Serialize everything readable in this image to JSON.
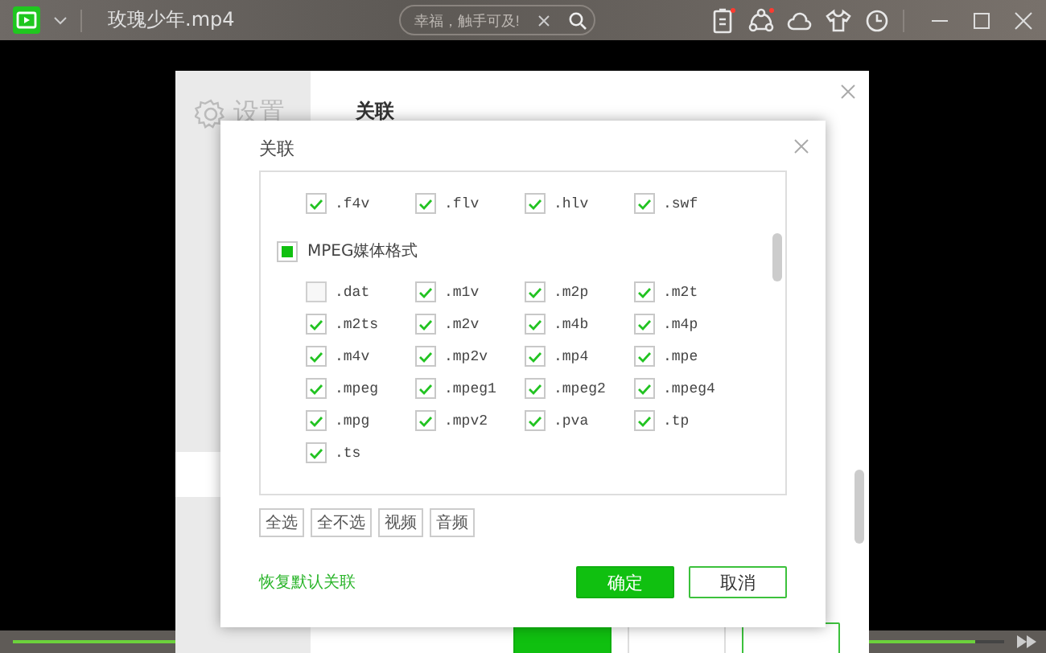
{
  "player": {
    "title": "玫瑰少年.mp4",
    "search": {
      "placeholder": "幸福，触手可及!"
    },
    "icons": [
      {
        "kind": "doc",
        "dot": true
      },
      {
        "kind": "share",
        "dot": true
      },
      {
        "kind": "cloud",
        "dot": false
      },
      {
        "kind": "shirt",
        "dot": false
      },
      {
        "kind": "clock",
        "dot": false
      }
    ],
    "progress": {
      "level": 0.97
    }
  },
  "settings": {
    "title": "设置",
    "section": "关联",
    "buttons": [
      {
        "kind": "primary"
      },
      {
        "kind": "disabled"
      },
      {
        "kind": "outline"
      }
    ]
  },
  "dialog": {
    "title": "关联",
    "groups": [
      {
        "items": [
          {
            "label": ".f4v",
            "checked": true
          },
          {
            "label": ".flv",
            "checked": true
          },
          {
            "label": ".hlv",
            "checked": true
          },
          {
            "label": ".swf",
            "checked": true
          }
        ]
      },
      {
        "name": "MPEG媒体格式",
        "indeterminate": true,
        "items": [
          {
            "label": ".dat",
            "checked": false
          },
          {
            "label": ".m1v",
            "checked": true
          },
          {
            "label": ".m2p",
            "checked": true
          },
          {
            "label": ".m2t",
            "checked": true
          },
          {
            "label": ".m2ts",
            "checked": true
          },
          {
            "label": ".m2v",
            "checked": true
          },
          {
            "label": ".m4b",
            "checked": true
          },
          {
            "label": ".m4p",
            "checked": true
          },
          {
            "label": ".m4v",
            "checked": true
          },
          {
            "label": ".mp2v",
            "checked": true
          },
          {
            "label": ".mp4",
            "checked": true
          },
          {
            "label": ".mpe",
            "checked": true
          },
          {
            "label": ".mpeg",
            "checked": true
          },
          {
            "label": ".mpeg1",
            "checked": true
          },
          {
            "label": ".mpeg2",
            "checked": true
          },
          {
            "label": ".mpeg4",
            "checked": true
          },
          {
            "label": ".mpg",
            "checked": true
          },
          {
            "label": ".mpv2",
            "checked": true
          },
          {
            "label": ".pva",
            "checked": true
          },
          {
            "label": ".tp",
            "checked": true
          },
          {
            "label": ".ts",
            "checked": true
          }
        ]
      }
    ],
    "filters": [
      "全选",
      "全不选",
      "视频",
      "音频"
    ],
    "restore": "恢复默认关联",
    "buttons": [
      {
        "label": "确定",
        "kind": "primary"
      },
      {
        "label": "取消",
        "kind": "outline"
      }
    ]
  }
}
